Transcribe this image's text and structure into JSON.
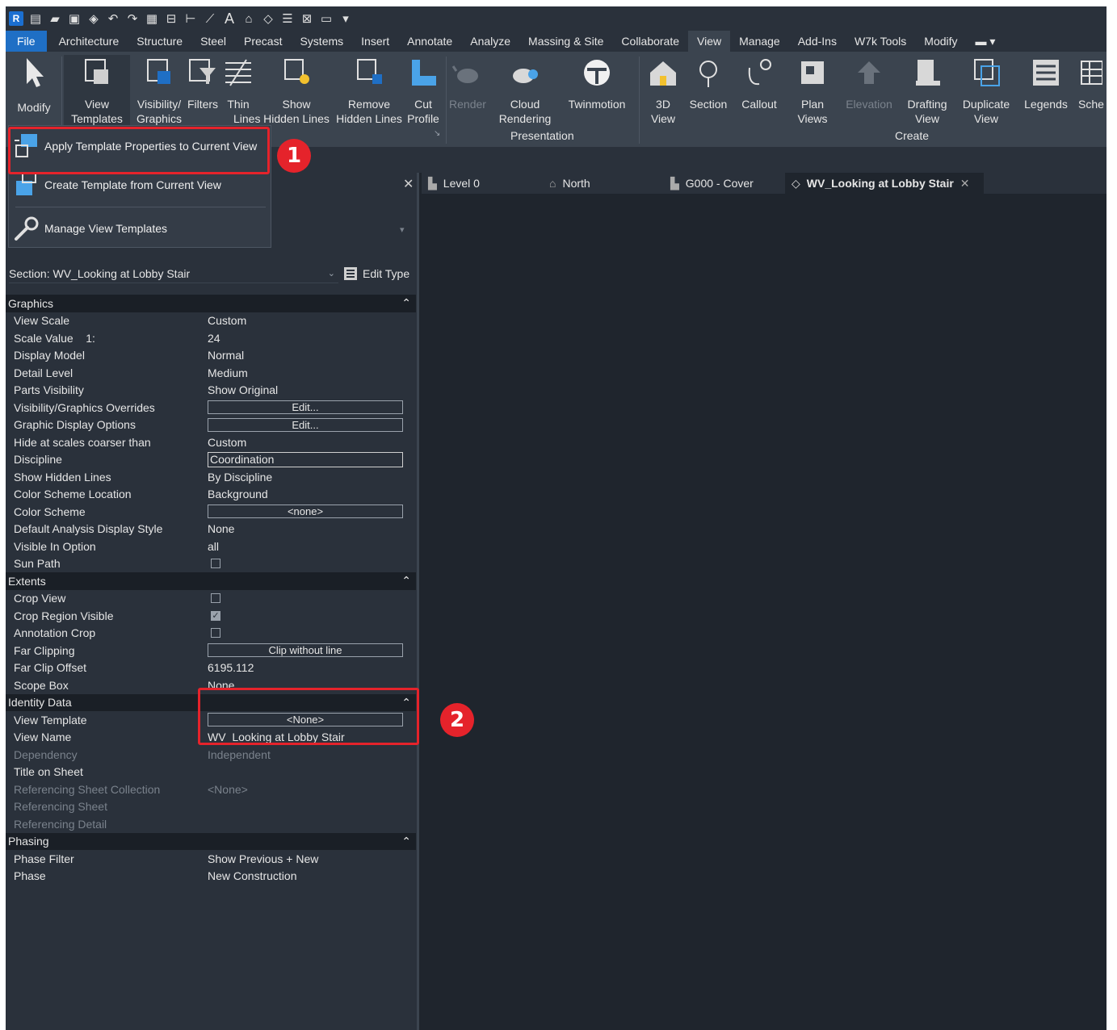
{
  "menu_tabs": [
    "File",
    "Architecture",
    "Structure",
    "Steel",
    "Precast",
    "Systems",
    "Insert",
    "Annotate",
    "Analyze",
    "Massing & Site",
    "Collaborate",
    "View",
    "Manage",
    "Add-Ins",
    "W7k Tools",
    "Modify"
  ],
  "active_tab": "View",
  "ribbon": {
    "modify": "Modify",
    "view_templates_1": "View",
    "view_templates_2": "Templates",
    "vis_graphics_1": "Visibility/",
    "vis_graphics_2": "Graphics",
    "filters": "Filters",
    "thin_1": "Thin",
    "thin_2": "Lines",
    "show_1": "Show",
    "show_2": "Hidden Lines",
    "remove_1": "Remove",
    "remove_2": "Hidden Lines",
    "cut_1": "Cut",
    "cut_2": "Profile",
    "render": "Render",
    "cloud_1": "Cloud",
    "cloud_2": "Rendering",
    "twinmotion": "Twinmotion",
    "view3d_1": "3D",
    "view3d_2": "View",
    "section": "Section",
    "callout": "Callout",
    "plan_1": "Plan",
    "plan_2": "Views",
    "elevation": "Elevation",
    "drafting_1": "Drafting",
    "drafting_2": "View",
    "duplicate_1": "Duplicate",
    "duplicate_2": "View",
    "legends": "Legends",
    "schedules": "Sche",
    "panel_presentation": "Presentation",
    "panel_create": "Create"
  },
  "dropdown": {
    "apply": "Apply Template Properties to Current View",
    "create": "Create Template from Current View",
    "manage": "Manage View Templates"
  },
  "badges": [
    "1",
    "2"
  ],
  "properties": {
    "type_selector": "Section: WV_Looking at Lobby Stair",
    "edit_type": "Edit Type",
    "groups": {
      "graphics": "Graphics",
      "extents": "Extents",
      "identity": "Identity Data",
      "phasing": "Phasing"
    },
    "graphics_rows": [
      {
        "k": "View Scale",
        "v": "Custom"
      },
      {
        "k": "Scale Value    1:",
        "v": "24"
      },
      {
        "k": "Display Model",
        "v": "Normal"
      },
      {
        "k": "Detail Level",
        "v": "Medium"
      },
      {
        "k": "Parts Visibility",
        "v": "Show Original"
      },
      {
        "k": "Visibility/Graphics Overrides",
        "v": "Edit..."
      },
      {
        "k": "Graphic Display Options",
        "v": "Edit..."
      },
      {
        "k": "Hide at scales coarser than",
        "v": "Custom"
      },
      {
        "k": "Discipline",
        "v": "Coordination"
      },
      {
        "k": "Show Hidden Lines",
        "v": "By Discipline"
      },
      {
        "k": "Color Scheme Location",
        "v": "Background"
      },
      {
        "k": "Color Scheme",
        "v": "<none>"
      },
      {
        "k": "Default Analysis Display Style",
        "v": "None"
      },
      {
        "k": "Visible In Option",
        "v": "all"
      },
      {
        "k": "Sun Path",
        "v": ""
      }
    ],
    "extents_rows": [
      {
        "k": "Crop View",
        "v": ""
      },
      {
        "k": "Crop Region Visible",
        "v": ""
      },
      {
        "k": "Annotation Crop",
        "v": ""
      },
      {
        "k": "Far Clipping",
        "v": "Clip without line"
      },
      {
        "k": "Far Clip Offset",
        "v": "6195.112"
      },
      {
        "k": "Scope Box",
        "v": "None"
      }
    ],
    "identity_rows": [
      {
        "k": "View Template",
        "v": "<None>"
      },
      {
        "k": "View Name",
        "v": "WV_Looking at Lobby Stair"
      },
      {
        "k": "Dependency",
        "v": "Independent"
      },
      {
        "k": "Title on Sheet",
        "v": ""
      },
      {
        "k": "Referencing Sheet Collection",
        "v": "<None>"
      },
      {
        "k": "Referencing Sheet",
        "v": ""
      },
      {
        "k": "Referencing Detail",
        "v": ""
      }
    ],
    "phasing_rows": [
      {
        "k": "Phase Filter",
        "v": "Show Previous + New"
      },
      {
        "k": "Phase",
        "v": "New Construction"
      }
    ]
  },
  "view_tabs": [
    "Level 0",
    "North",
    "G000 - Cover",
    "WV_Looking at Lobby Stair"
  ],
  "colors": {
    "accent": "#1f6fc5",
    "annotation": "#e5232b",
    "bg": "#1f252d"
  }
}
